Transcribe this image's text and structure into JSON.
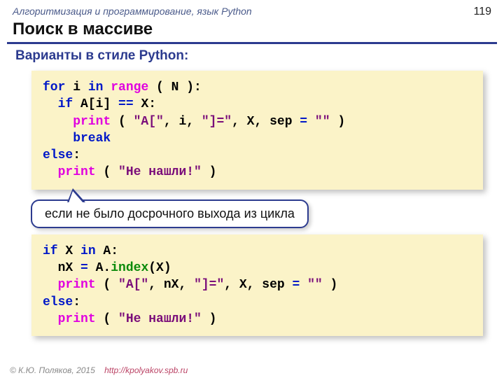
{
  "header": {
    "topic": "Алгоритмизация и программирование, язык Python",
    "page": "119"
  },
  "title": "Поиск в массиве",
  "subtitle": "Варианты в стиле Python:",
  "code1": {
    "l1a": "for",
    "l1b": " i ",
    "l1c": "in",
    "l1d": " ",
    "l1e": "range",
    "l1f": " ( N ):",
    "l2a": "  if",
    "l2b": " A[i] ",
    "l2c": "==",
    "l2d": " X:",
    "l3a": "    print",
    "l3b": " ( ",
    "l3c": "\"A[\"",
    "l3d": ", i, ",
    "l3e": "\"]=\"",
    "l3f": ", X, sep ",
    "l3g": "=",
    "l3h": " ",
    "l3i": "\"\"",
    "l3j": " )",
    "l4a": "    break",
    "l5a": "else",
    "l5b": ":",
    "l6a": "  print",
    "l6b": " ( ",
    "l6c": "\"Не нашли!\"",
    "l6d": " )"
  },
  "callout": "если не было досрочного выхода из цикла",
  "code2": {
    "l1a": "if",
    "l1b": " X ",
    "l1c": "in",
    "l1d": " A:",
    "l2a": "  nX ",
    "l2b": "=",
    "l2c": " A.",
    "l2d": "index",
    "l2e": "(X)",
    "l3a": "  print",
    "l3b": " ( ",
    "l3c": "\"A[\"",
    "l3d": ", nX, ",
    "l3e": "\"]=\"",
    "l3f": ", X, sep ",
    "l3g": "=",
    "l3h": " ",
    "l3i": "\"\"",
    "l3j": " )",
    "l4a": "else",
    "l4b": ":",
    "l5a": "  print",
    "l5b": " ( ",
    "l5c": "\"Не нашли!\"",
    "l5d": " )"
  },
  "footer": {
    "copyright": "© К.Ю. Поляков, 2015",
    "url": "http://kpolyakov.spb.ru"
  }
}
